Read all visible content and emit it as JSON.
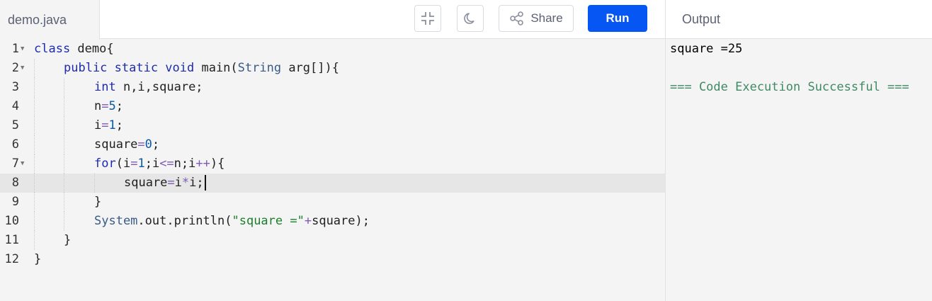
{
  "header": {
    "file_tab": "demo.java",
    "share_label": "Share",
    "run_label": "Run",
    "output_tab": "Output"
  },
  "icons": {
    "fullscreen": "exit-fullscreen-icon",
    "theme": "moon-icon",
    "share": "share-icon"
  },
  "editor": {
    "active_line": 8,
    "line_numbers": [
      "1",
      "2",
      "3",
      "4",
      "5",
      "6",
      "7",
      "8",
      "9",
      "10",
      "11",
      "12"
    ],
    "lines": {
      "l1": {
        "kw": "class",
        "rest": " demo{"
      },
      "l2": {
        "kw": "public static void",
        "rest": " main(",
        "type": "String",
        "rest2": " arg[]){"
      },
      "l3": {
        "kw": "int",
        "rest": " n,i,square;"
      },
      "l4": {
        "a": "n",
        "op": "=",
        "num": "5",
        "end": ";"
      },
      "l5": {
        "a": "i",
        "op": "=",
        "num": "1",
        "end": ";"
      },
      "l6": {
        "a": "square",
        "op": "=",
        "num": "0",
        "end": ";"
      },
      "l7": {
        "kw": "for",
        "p1": "(i",
        "op1": "=",
        "num": "1",
        "p2": ";i",
        "op2": "<=",
        "p3": "n;i",
        "op3": "++",
        "p4": "){"
      },
      "l8": {
        "a": "square",
        "op1": "=",
        "b": "i",
        "op2": "*",
        "c": "i;"
      },
      "l9": {
        "text": "}"
      },
      "l10": {
        "sys": "System",
        "mid": ".out.println(",
        "str": "\"square =\"",
        "op": "+",
        "end": "square);"
      },
      "l11": {
        "text": "}"
      },
      "l12": {
        "text": "}"
      }
    }
  },
  "output": {
    "line1": "square =25",
    "line2": "",
    "line3": "=== Code Execution Successful ==="
  },
  "colors": {
    "run_button": "#0556f3",
    "keyword": "#1d2bb1",
    "string": "#1a7f2a",
    "success": "#3e8a63"
  }
}
